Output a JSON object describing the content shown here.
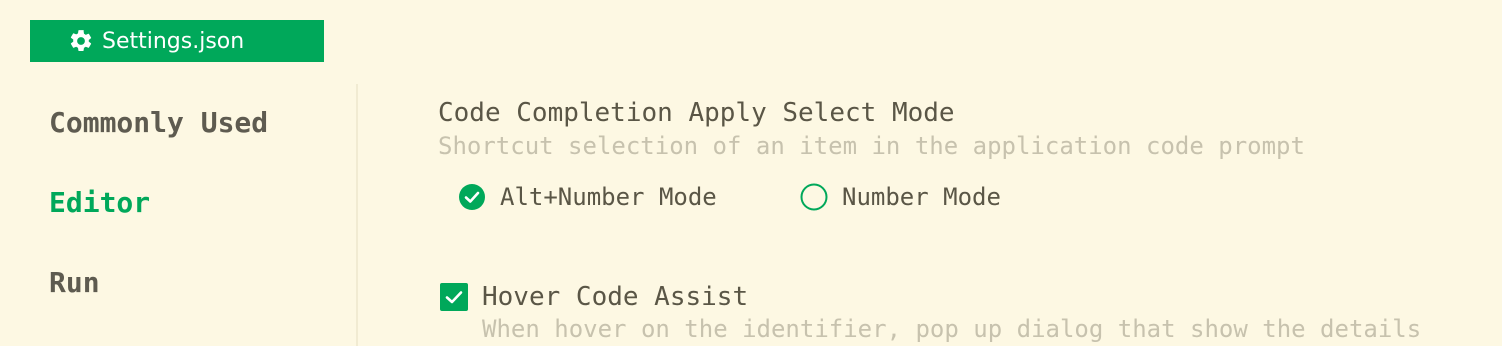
{
  "header": {
    "file_button_label": "Settings.json",
    "icon": "gear-icon"
  },
  "sidebar": {
    "items": [
      {
        "label": "Commonly Used",
        "active": false
      },
      {
        "label": "Editor",
        "active": true
      },
      {
        "label": "Run",
        "active": false
      }
    ]
  },
  "settings": {
    "completion_mode": {
      "title": "Code Completion Apply Select Mode",
      "description": "Shortcut selection of an item in the application code prompt",
      "options": [
        {
          "label": "Alt+Number Mode",
          "selected": true
        },
        {
          "label": "Number Mode",
          "selected": false
        }
      ]
    },
    "hover_assist": {
      "label": "Hover Code Assist",
      "checked": true,
      "description": "When hover on the identifier, pop up dialog that show the details"
    }
  },
  "colors": {
    "accent": "#00a85a",
    "background": "#fdf8e3",
    "text": "#5a5646",
    "muted": "#c7c2ae"
  }
}
